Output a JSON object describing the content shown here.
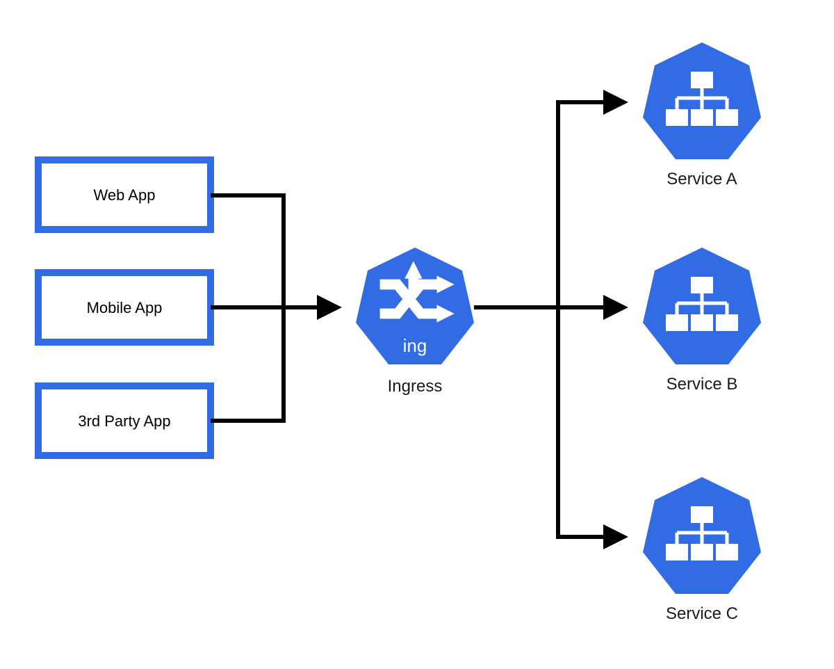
{
  "colors": {
    "accent": "#326ce5",
    "line": "#000000",
    "bg": "#ffffff"
  },
  "clients": [
    {
      "label": "Web App"
    },
    {
      "label": "Mobile App"
    },
    {
      "label": "3rd Party App"
    }
  ],
  "ingress": {
    "icon_label": "ing",
    "label": "Ingress"
  },
  "services": [
    {
      "label": "Service A"
    },
    {
      "label": "Service B"
    },
    {
      "label": "Service C"
    }
  ]
}
